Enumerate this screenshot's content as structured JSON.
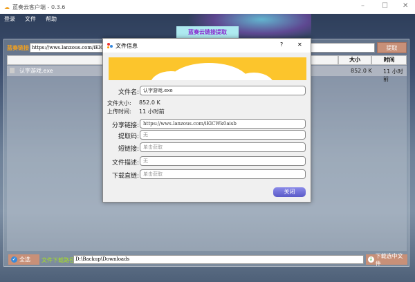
{
  "window": {
    "title": "蓝奏云客户端 - 0.3.6",
    "minimize": "–",
    "maximize": "☐",
    "close": "✕"
  },
  "menu": [
    "登录",
    "文件",
    "帮助"
  ],
  "tab": "蓝奏云链接提取",
  "link": {
    "label": "蓝奏链接",
    "value": "https://wws.lanzous.com/iKlCWk0aisb",
    "button": "提取"
  },
  "table": {
    "headers": {
      "size": "大小",
      "time": "时间"
    },
    "rows": [
      {
        "name": "认字游戏.exe",
        "size": "852.0 K",
        "time": "11 小时前"
      }
    ]
  },
  "bottom": {
    "select_all": "全选",
    "path_label": "文件下载路径",
    "path": "D:\\Backup\\Downloads",
    "download": "下载选中文件"
  },
  "dialog": {
    "title": "文件信息",
    "help": "?",
    "close_x": "✕",
    "name_label": "文件名:",
    "name": "认字游戏.exe",
    "size_label": "文件大小:",
    "size": "852.0 K",
    "time_label": "上传时间:",
    "time": "11 小时前",
    "share_label": "分享链接:",
    "share": "https://wws.lanzous.com/iKlCWk0aisb",
    "code_label": "提取码:",
    "code": "无",
    "short_label": "短链接:",
    "short": "单击获取",
    "desc_label": "文件描述:",
    "desc": "无",
    "direct_label": "下载直链:",
    "direct": "单击获取",
    "close_button": "关闭"
  },
  "colors": {
    "banner": "#fcc52c",
    "tab_text": "#8a2bd0",
    "button": "#c89078"
  }
}
